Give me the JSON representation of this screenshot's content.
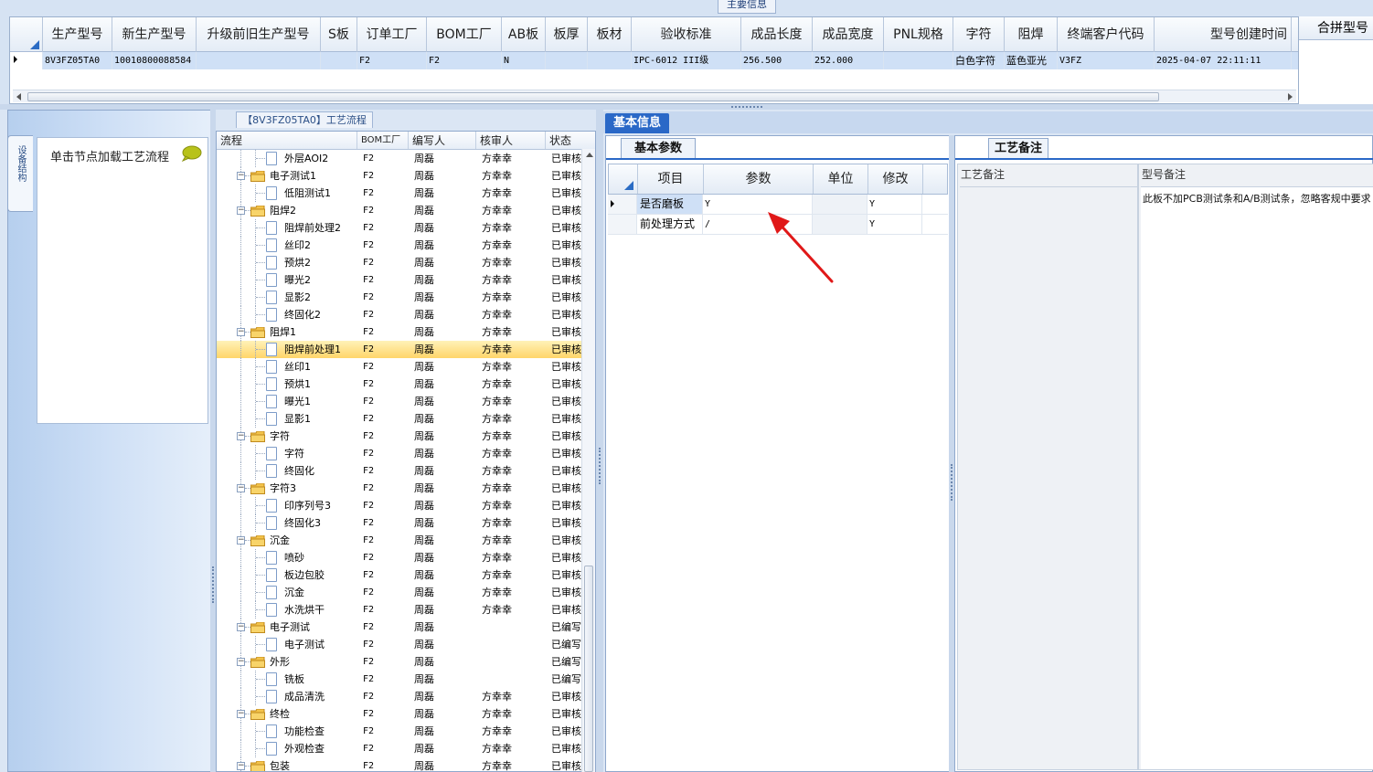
{
  "main_info": {
    "caption": "主要信息",
    "columns": [
      "生产型号",
      "新生产型号",
      "升级前旧生产型号",
      "S板",
      "订单工厂",
      "BOM工厂",
      "AB板",
      "板厚",
      "板材",
      "验收标准",
      "成品长度",
      "成品宽度",
      "PNL规格",
      "字符",
      "阻焊",
      "终端客户代码",
      "型号创建时间"
    ],
    "row": [
      "8V3FZ05TA0",
      "10010800088584",
      "",
      "",
      "F2",
      "F2",
      "N",
      "",
      "",
      "IPC-6012 III级",
      "256.500",
      "252.000",
      "",
      "白色字符",
      "蓝色亚光",
      "V3FZ",
      "2025-04-07 22:11:11"
    ],
    "merge_header": "合拼型号"
  },
  "left_nav": {
    "vertical_tab": "设备结构",
    "load_label": "单击节点加载工艺流程"
  },
  "tree": {
    "caption": "【8V3FZ05TA0】工艺流程",
    "columns": [
      "流程",
      "BOM工厂",
      "编写人",
      "核审人",
      "状态"
    ],
    "rows": [
      {
        "name": "外层AOI2",
        "level": 2,
        "bom": "F2",
        "writer": "周磊",
        "reviewer": "方幸幸",
        "status": "已审核",
        "selected": false
      },
      {
        "name": "电子测试1",
        "level": 1,
        "bom": "F2",
        "writer": "周磊",
        "reviewer": "方幸幸",
        "status": "已审核",
        "selected": false
      },
      {
        "name": "低阻测试1",
        "level": 2,
        "bom": "F2",
        "writer": "周磊",
        "reviewer": "方幸幸",
        "status": "已审核",
        "selected": false
      },
      {
        "name": "阻焊2",
        "level": 1,
        "bom": "F2",
        "writer": "周磊",
        "reviewer": "方幸幸",
        "status": "已审核",
        "selected": false
      },
      {
        "name": "阻焊前处理2",
        "level": 2,
        "bom": "F2",
        "writer": "周磊",
        "reviewer": "方幸幸",
        "status": "已审核",
        "selected": false
      },
      {
        "name": "丝印2",
        "level": 2,
        "bom": "F2",
        "writer": "周磊",
        "reviewer": "方幸幸",
        "status": "已审核",
        "selected": false
      },
      {
        "name": "预烘2",
        "level": 2,
        "bom": "F2",
        "writer": "周磊",
        "reviewer": "方幸幸",
        "status": "已审核",
        "selected": false
      },
      {
        "name": "曝光2",
        "level": 2,
        "bom": "F2",
        "writer": "周磊",
        "reviewer": "方幸幸",
        "status": "已审核",
        "selected": false
      },
      {
        "name": "显影2",
        "level": 2,
        "bom": "F2",
        "writer": "周磊",
        "reviewer": "方幸幸",
        "status": "已审核",
        "selected": false
      },
      {
        "name": "终固化2",
        "level": 2,
        "bom": "F2",
        "writer": "周磊",
        "reviewer": "方幸幸",
        "status": "已审核",
        "selected": false
      },
      {
        "name": "阻焊1",
        "level": 1,
        "bom": "F2",
        "writer": "周磊",
        "reviewer": "方幸幸",
        "status": "已审核",
        "selected": false
      },
      {
        "name": "阻焊前处理1",
        "level": 2,
        "bom": "F2",
        "writer": "周磊",
        "reviewer": "方幸幸",
        "status": "已审核",
        "selected": true
      },
      {
        "name": "丝印1",
        "level": 2,
        "bom": "F2",
        "writer": "周磊",
        "reviewer": "方幸幸",
        "status": "已审核",
        "selected": false
      },
      {
        "name": "预烘1",
        "level": 2,
        "bom": "F2",
        "writer": "周磊",
        "reviewer": "方幸幸",
        "status": "已审核",
        "selected": false
      },
      {
        "name": "曝光1",
        "level": 2,
        "bom": "F2",
        "writer": "周磊",
        "reviewer": "方幸幸",
        "status": "已审核",
        "selected": false
      },
      {
        "name": "显影1",
        "level": 2,
        "bom": "F2",
        "writer": "周磊",
        "reviewer": "方幸幸",
        "status": "已审核",
        "selected": false
      },
      {
        "name": "字符",
        "level": 1,
        "bom": "F2",
        "writer": "周磊",
        "reviewer": "方幸幸",
        "status": "已审核",
        "selected": false
      },
      {
        "name": "字符",
        "level": 2,
        "bom": "F2",
        "writer": "周磊",
        "reviewer": "方幸幸",
        "status": "已审核",
        "selected": false
      },
      {
        "name": "终固化",
        "level": 2,
        "bom": "F2",
        "writer": "周磊",
        "reviewer": "方幸幸",
        "status": "已审核",
        "selected": false
      },
      {
        "name": "字符3",
        "level": 1,
        "bom": "F2",
        "writer": "周磊",
        "reviewer": "方幸幸",
        "status": "已审核",
        "selected": false
      },
      {
        "name": "印序列号3",
        "level": 2,
        "bom": "F2",
        "writer": "周磊",
        "reviewer": "方幸幸",
        "status": "已审核",
        "selected": false
      },
      {
        "name": "终固化3",
        "level": 2,
        "bom": "F2",
        "writer": "周磊",
        "reviewer": "方幸幸",
        "status": "已审核",
        "selected": false
      },
      {
        "name": "沉金",
        "level": 1,
        "bom": "F2",
        "writer": "周磊",
        "reviewer": "方幸幸",
        "status": "已审核",
        "selected": false
      },
      {
        "name": "喷砂",
        "level": 2,
        "bom": "F2",
        "writer": "周磊",
        "reviewer": "方幸幸",
        "status": "已审核",
        "selected": false
      },
      {
        "name": "板边包胶",
        "level": 2,
        "bom": "F2",
        "writer": "周磊",
        "reviewer": "方幸幸",
        "status": "已审核",
        "selected": false
      },
      {
        "name": "沉金",
        "level": 2,
        "bom": "F2",
        "writer": "周磊",
        "reviewer": "方幸幸",
        "status": "已审核",
        "selected": false
      },
      {
        "name": "水洗烘干",
        "level": 2,
        "bom": "F2",
        "writer": "周磊",
        "reviewer": "方幸幸",
        "status": "已审核",
        "selected": false
      },
      {
        "name": "电子测试",
        "level": 1,
        "bom": "F2",
        "writer": "周磊",
        "reviewer": "",
        "status": "已编写",
        "selected": false
      },
      {
        "name": "电子测试",
        "level": 2,
        "bom": "F2",
        "writer": "周磊",
        "reviewer": "",
        "status": "已编写",
        "selected": false
      },
      {
        "name": "外形",
        "level": 1,
        "bom": "F2",
        "writer": "周磊",
        "reviewer": "",
        "status": "已编写",
        "selected": false
      },
      {
        "name": "铣板",
        "level": 2,
        "bom": "F2",
        "writer": "周磊",
        "reviewer": "",
        "status": "已编写",
        "selected": false
      },
      {
        "name": "成品清洗",
        "level": 2,
        "bom": "F2",
        "writer": "周磊",
        "reviewer": "方幸幸",
        "status": "已审核",
        "selected": false
      },
      {
        "name": "终检",
        "level": 1,
        "bom": "F2",
        "writer": "周磊",
        "reviewer": "方幸幸",
        "status": "已审核",
        "selected": false
      },
      {
        "name": "功能检查",
        "level": 2,
        "bom": "F2",
        "writer": "周磊",
        "reviewer": "方幸幸",
        "status": "已审核",
        "selected": false
      },
      {
        "name": "外观检查",
        "level": 2,
        "bom": "F2",
        "writer": "周磊",
        "reviewer": "方幸幸",
        "status": "已审核",
        "selected": false
      },
      {
        "name": "包装",
        "level": 1,
        "bom": "F2",
        "writer": "周磊",
        "reviewer": "方幸幸",
        "status": "已审核",
        "selected": false
      }
    ]
  },
  "basic_info": {
    "tab_label": "基本信息",
    "param_tab": "基本参数",
    "columns": [
      "项目",
      "参数",
      "单位",
      "修改"
    ],
    "rows": [
      {
        "item": "是否磨板",
        "param": "Y",
        "unit": "",
        "modify": "Y"
      },
      {
        "item": "前处理方式",
        "param": "/",
        "unit": "",
        "modify": "Y"
      }
    ]
  },
  "remarks": {
    "tab_label": "工艺备注",
    "process_remark_title": "工艺备注",
    "model_remark_title": "型号备注",
    "model_remark_text": "此板不加PCB测试条和A/B测试条，忽略客规中要求"
  },
  "colors": {
    "accent": "#2a68c7",
    "selected_row": "#ffd56a",
    "annotation_arrow": "#e01818"
  }
}
